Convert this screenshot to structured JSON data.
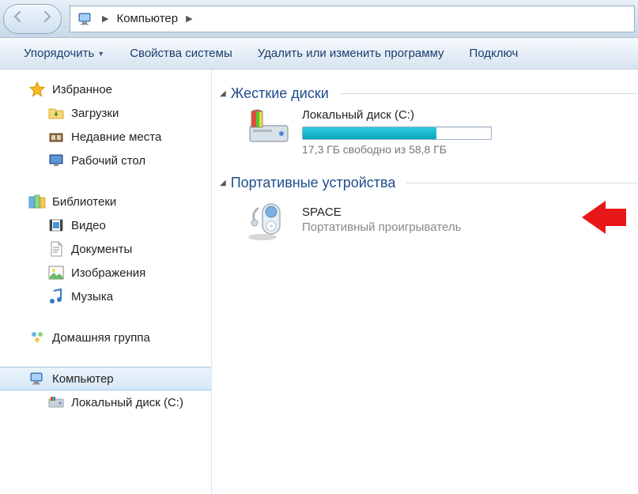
{
  "breadcrumb": {
    "location": "Компьютер"
  },
  "toolbar": {
    "organize": "Упорядочить",
    "system_props": "Свойства системы",
    "uninstall": "Удалить или изменить программу",
    "connect": "Подключ"
  },
  "sidebar": {
    "favorites": {
      "label": "Избранное"
    },
    "downloads": {
      "label": "Загрузки"
    },
    "recent": {
      "label": "Недавние места"
    },
    "desktop": {
      "label": "Рабочий стол"
    },
    "libraries": {
      "label": "Библиотеки"
    },
    "videos": {
      "label": "Видео"
    },
    "documents": {
      "label": "Документы"
    },
    "pictures": {
      "label": "Изображения"
    },
    "music": {
      "label": "Музыка"
    },
    "homegroup": {
      "label": "Домашняя группа"
    },
    "computer": {
      "label": "Компьютер"
    },
    "local_disk_c": {
      "label": "Локальный диск (C:)"
    }
  },
  "content": {
    "section_hdd": "Жесткие диски",
    "section_portable": "Портативные устройства",
    "drive": {
      "name": "Локальный диск (C:)",
      "free_text": "17,3 ГБ свободно из 58,8 ГБ",
      "fill_percent": 71
    },
    "device": {
      "name": "SPACE",
      "subtitle": "Портативный проигрыватель"
    }
  }
}
